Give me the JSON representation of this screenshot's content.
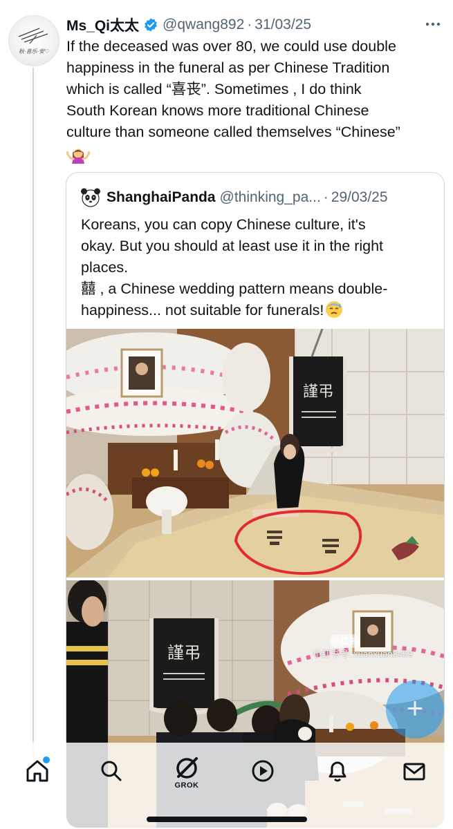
{
  "tweet": {
    "author_name": "Ms_Qi太太",
    "handle": "@qwang892",
    "separator": "·",
    "date": "31/03/25",
    "text": "If the deceased was over 80, we could use double\nhappiness in the funeral as per Chinese Tradition\nwhich is called “喜丧”. Sometimes , I do think\nSouth Korean knows more traditional Chinese\nculture than someone called themselves “Chinese”",
    "emoji": "woman-shrugging-icon",
    "avatar_signature": "秋·喜乐·安♡"
  },
  "quote": {
    "author_name": "ShanghaiPanda",
    "handle": "@thinking_pa...",
    "separator": "·",
    "date": "29/03/25",
    "text": "Koreans, you can copy Chinese culture, it's\nokay. But you should at least use it in the right\nplaces.\n囍 , a Chinese wedding pattern means double-\nhappiness... not suitable for funerals!",
    "emoji": "anxious-sweat-face-icon"
  },
  "media": {
    "banner_text_1": "謹弔",
    "banner_text_2": "謹弔",
    "watermark_logo": "小红书",
    "watermark_id": "小红书号: xuanxuan3459"
  },
  "tabbar": {
    "items": [
      "home-icon",
      "search-icon",
      "grok-icon",
      "video-icon",
      "notifications-icon",
      "messages-icon"
    ],
    "grok_label": "GROK"
  },
  "colors": {
    "accent": "#1d9bf0",
    "text_primary": "#0f1419",
    "text_secondary": "#536471",
    "border": "#cfd9de"
  }
}
